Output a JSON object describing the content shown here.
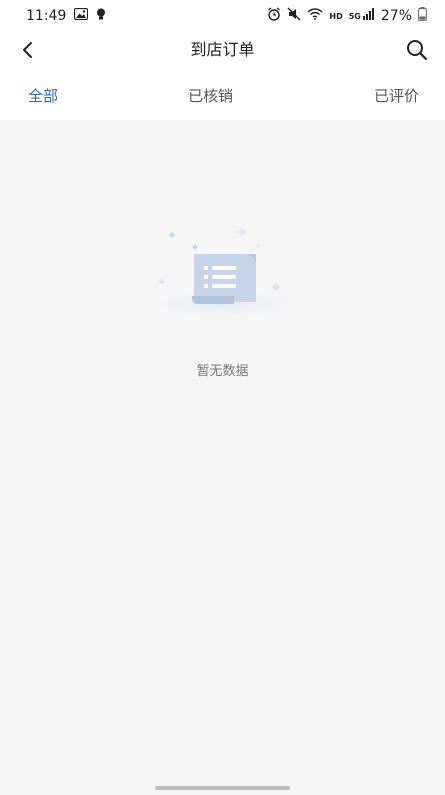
{
  "status_bar": {
    "time": "11:49",
    "hd_label": "HD",
    "network_label": "5G",
    "battery": "27%"
  },
  "header": {
    "title": "到店订单"
  },
  "tabs": [
    {
      "label": "全部",
      "active": true
    },
    {
      "label": "已核销",
      "active": false
    },
    {
      "label": "已评价",
      "active": false
    }
  ],
  "empty_state": {
    "message": "暂无数据"
  },
  "colors": {
    "accent": "#2c6ab4",
    "background": "#f6f6f7"
  }
}
